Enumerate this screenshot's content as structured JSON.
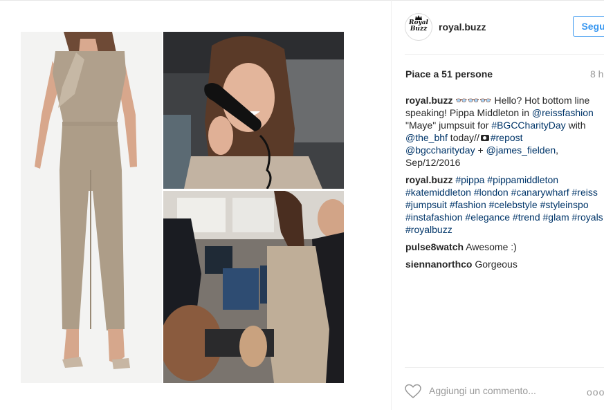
{
  "post": {
    "username": "royal.buzz",
    "avatar_text": "Royal Buzz",
    "follow_label": "Segui",
    "likes_text": "Piace a 51 persone",
    "time_text": "8 h"
  },
  "caption": {
    "user": "royal.buzz",
    "emoji": "👓👓👓",
    "text1": " Hello? Hot bottom line speaking! Pippa Middleton in ",
    "mention1": "@reissfashion",
    "text2": " \"Maye\" jumpsuit for ",
    "tag1": "#BGCCharityDay",
    "text3": " with ",
    "mention2": "@the_bhf",
    "text4": " today//",
    "tag2": "#repost",
    "mention3": "@bgccharityday",
    "text5": " + ",
    "mention4": "@james_fielden",
    "text6": ", Sep/12/2016"
  },
  "hashtags_comment": {
    "user": "royal.buzz",
    "tags": [
      "#pippa",
      "#pippamiddleton",
      "#katemiddleton",
      "#london",
      "#canarywharf",
      "#reiss",
      "#jumpsuit",
      "#fashion",
      "#celebstyle",
      "#styleinspo",
      "#instafashion",
      "#elegance",
      "#trend",
      "#glam",
      "#royals",
      "#royalbuzz"
    ]
  },
  "comments": [
    {
      "user": "pulse8watch",
      "text": " Awesome :)"
    },
    {
      "user": "siennanorthco",
      "text": " Gorgeous"
    }
  ],
  "footer": {
    "add_comment_placeholder": "Aggiungi un commento...",
    "more_label": "ooo"
  },
  "icons": {
    "like": "heart-icon",
    "more": "more-options-icon",
    "camera": "camera-icon"
  },
  "colors": {
    "link": "#003569",
    "accent": "#3897f0",
    "muted": "#999999"
  }
}
